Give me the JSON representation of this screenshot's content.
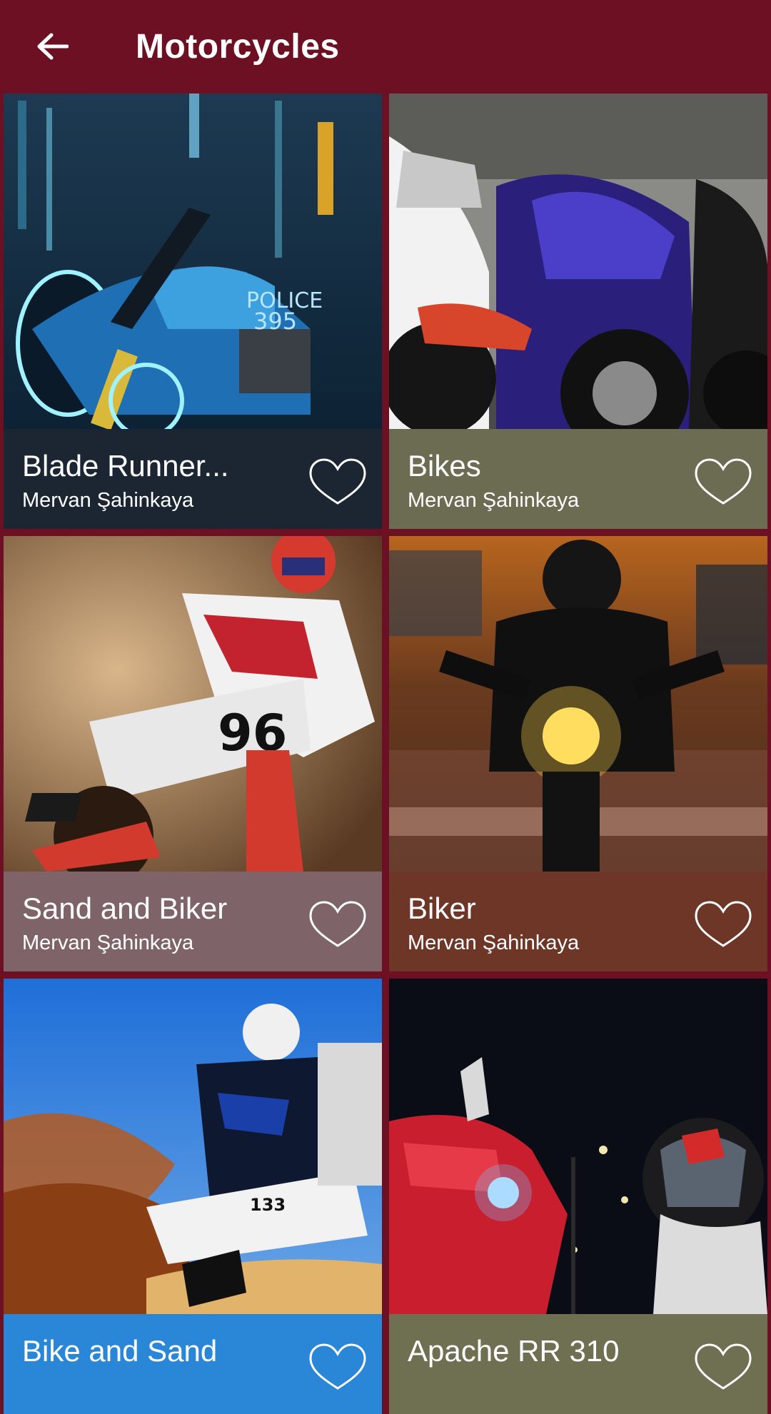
{
  "appbar": {
    "title": "Motorcycles",
    "back_icon": "arrow-left-icon"
  },
  "colors": {
    "appbar_bg": "#6e1024",
    "card_footers": [
      "#1c2633",
      "#6c6c52",
      "#7e6469",
      "#6d3627",
      "#2a86d6",
      "#6f6f52"
    ]
  },
  "cards": [
    {
      "title": "Blade Runner...",
      "author": "Mervan Şahinkaya",
      "favorite_icon": "heart-outline-icon"
    },
    {
      "title": "Bikes",
      "author": "Mervan Şahinkaya",
      "favorite_icon": "heart-outline-icon"
    },
    {
      "title": "Sand and Biker",
      "author": "Mervan Şahinkaya",
      "favorite_icon": "heart-outline-icon"
    },
    {
      "title": "Biker",
      "author": "Mervan Şahinkaya",
      "favorite_icon": "heart-outline-icon"
    },
    {
      "title": "Bike and Sand",
      "author": "",
      "favorite_icon": "heart-outline-icon"
    },
    {
      "title": "Apache RR 310",
      "author": "",
      "favorite_icon": "heart-outline-icon"
    }
  ]
}
